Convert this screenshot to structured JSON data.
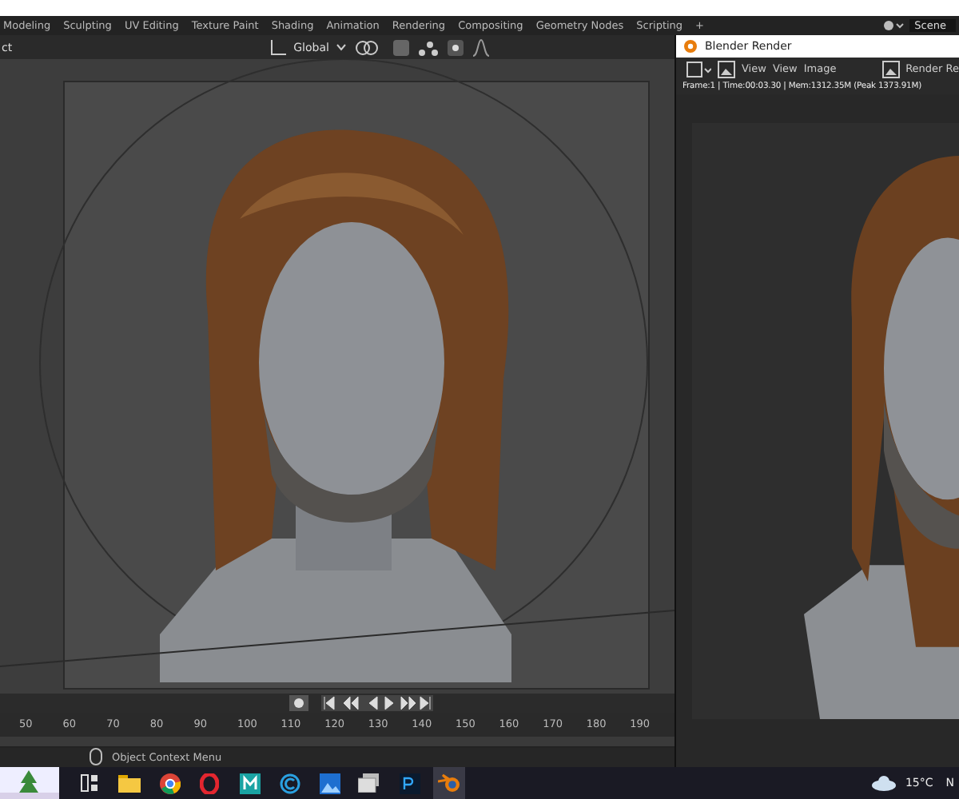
{
  "workspace_tabs": [
    {
      "label": "Modeling"
    },
    {
      "label": "Sculpting"
    },
    {
      "label": "UV Editing"
    },
    {
      "label": "Texture Paint"
    },
    {
      "label": "Shading"
    },
    {
      "label": "Animation"
    },
    {
      "label": "Rendering"
    },
    {
      "label": "Compositing"
    },
    {
      "label": "Geometry Nodes"
    },
    {
      "label": "Scripting"
    },
    {
      "label": "+"
    }
  ],
  "scene": {
    "label": "Scene"
  },
  "viewport_header": {
    "mode": "ct",
    "orientation": "Global"
  },
  "render_window": {
    "title": "Blender Render",
    "menus": [
      "View",
      "View",
      "Image"
    ],
    "slot": "Render Re",
    "info": "Frame:1 | Time:00:03.30 | Mem:1312.35M (Peak 1373.91M)"
  },
  "timeline": {
    "ticks": [
      "50",
      "60",
      "70",
      "80",
      "90",
      "100",
      "110",
      "120",
      "130",
      "140",
      "150",
      "160",
      "170",
      "180",
      "190"
    ]
  },
  "status_bar": {
    "hint": "Object Context Menu"
  },
  "taskbar": {
    "apps": [
      {
        "kind": "taskview",
        "active": false
      },
      {
        "kind": "folder",
        "active": false
      },
      {
        "kind": "chrome",
        "active": false
      },
      {
        "kind": "opera",
        "active": false
      },
      {
        "kind": "m",
        "active": false
      },
      {
        "kind": "c",
        "active": false
      },
      {
        "kind": "photos",
        "active": false
      },
      {
        "kind": "stack",
        "active": false
      },
      {
        "kind": "ps",
        "active": false
      },
      {
        "kind": "blender",
        "active": true
      }
    ],
    "weather": "15°C",
    "clock": "N"
  }
}
